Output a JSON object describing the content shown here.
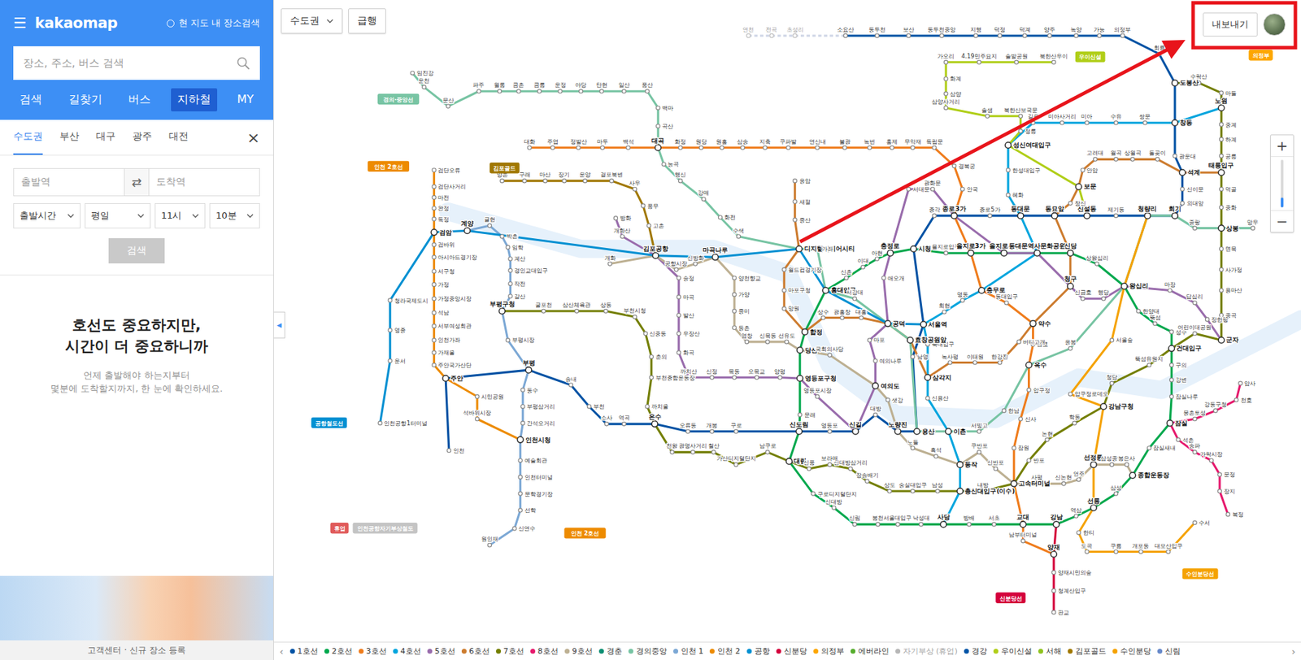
{
  "sidebar": {
    "menu_icon": "☰",
    "logo": "kakaomap",
    "area_search": {
      "label": "현 지도 내 장소검색",
      "checked": false
    },
    "search": {
      "placeholder": "장소, 주소, 버스 검색"
    },
    "nav_tabs": [
      {
        "label": "검색",
        "selected": false
      },
      {
        "label": "길찾기",
        "selected": false
      },
      {
        "label": "버스",
        "selected": false
      },
      {
        "label": "지하철",
        "selected": true
      },
      {
        "label": "MY",
        "selected": false
      }
    ],
    "region_tabs": [
      {
        "label": "수도권",
        "selected": true
      },
      {
        "label": "부산",
        "selected": false
      },
      {
        "label": "대구",
        "selected": false
      },
      {
        "label": "광주",
        "selected": false
      },
      {
        "label": "대전",
        "selected": false
      }
    ],
    "close": "×",
    "route": {
      "from_placeholder": "출발역",
      "to_placeholder": "도착역",
      "swap": "⇄"
    },
    "selects": [
      "출발시간",
      "평일",
      "11시",
      "10분"
    ],
    "submit": {
      "label": "검색",
      "disabled": true
    },
    "promo": {
      "title": [
        "호선도 중요하지만,",
        "시간이 더 중요하니까"
      ],
      "body": [
        "언제 출발해야 하는지부터",
        "몇분에 도착할지까지, 한 눈에 확인하세요."
      ]
    },
    "footer": "고객센터 · 신규 장소 등록",
    "collapse": "◀"
  },
  "map": {
    "region": "수도권",
    "express": "급행",
    "export": "내보내기",
    "zoom_in": "+",
    "zoom_out": "−",
    "zoom": {
      "level": 0.2
    },
    "legend_prev": "‹",
    "legend_next": "›",
    "faded_stations": [
      "연천",
      "전곡",
      "초성리"
    ],
    "badges": [
      {
        "text": "경의·중앙선",
        "color": "#77c4a3"
      },
      {
        "text": "인천 2호선",
        "color": "#ed8b00"
      },
      {
        "text": "김포골드",
        "color": "#a17800"
      },
      {
        "text": "우이신설",
        "color": "#b0ce18"
      },
      {
        "text": "공항철도선",
        "color": "#0090d2"
      },
      {
        "text": "의정부",
        "color": "#fda600"
      },
      {
        "text": "신분당선",
        "color": "#d4003b"
      },
      {
        "text": "수인분당선",
        "color": "#f5a200"
      },
      {
        "text": "휴업",
        "color": "#e05a5a"
      },
      {
        "text": "인천공항자기부상철도",
        "color": "#c4c4c4"
      },
      {
        "text": "인천 2호선",
        "color": "#ed8b00"
      }
    ],
    "stations": [
      "소요산",
      "동두천",
      "보산",
      "동두천중앙",
      "지행",
      "덕정",
      "덕계",
      "양주",
      "녹양",
      "가능",
      "의정부",
      "회룡",
      "도봉산",
      "창동",
      "광운대",
      "석계",
      "신이문",
      "외대앞",
      "회기",
      "청량리",
      "제기동",
      "신설동",
      "동묘앞",
      "동대문",
      "종로5가",
      "종로3가",
      "종각",
      "시청",
      "서울역",
      "남영",
      "용산",
      "노량진",
      "대방",
      "신길",
      "영등포",
      "신도림",
      "구로",
      "개봉",
      "오류동",
      "온수",
      "역곡",
      "소사",
      "부천",
      "송내",
      "부평",
      "주안",
      "인천",
      "을지로입구",
      "을지로3가",
      "을지로4가",
      "동대문역사문화공원",
      "신당",
      "상왕십리",
      "왕십리",
      "한양대",
      "뚝섬",
      "성수",
      "건대입구",
      "구의",
      "강변",
      "잠실나루",
      "잠실",
      "잠실새내",
      "종합운동장",
      "삼성",
      "선릉",
      "역삼",
      "강남",
      "교대",
      "서초",
      "방배",
      "사당",
      "낙성대",
      "서울대입구",
      "봉천",
      "신림",
      "신대방",
      "구로디지털단지",
      "대림",
      "문래",
      "영등포구청",
      "당산",
      "합정",
      "홍대입구",
      "신촌",
      "이대",
      "아현",
      "충정로",
      "대화",
      "주엽",
      "정발산",
      "마두",
      "백석",
      "대곡",
      "화정",
      "원당",
      "원흥",
      "삼송",
      "지축",
      "구파발",
      "연신내",
      "불광",
      "녹번",
      "홍제",
      "무악재",
      "독립문",
      "경복궁",
      "안국",
      "충무로",
      "동대입구",
      "약수",
      "금호",
      "옥수",
      "압구정",
      "신사",
      "잠원",
      "고속터미널",
      "남부터미널",
      "양재",
      "노원",
      "쌍문",
      "수유",
      "미아",
      "미아사거리",
      "길음",
      "성신여대입구",
      "한성대입구",
      "혜화",
      "명동",
      "회현",
      "숙대입구",
      "삼각지",
      "신용산",
      "이촌",
      "동작",
      "총신대입구(이수)",
      "방화",
      "개화산",
      "김포공항",
      "송정",
      "마곡",
      "발산",
      "우장산",
      "화곡",
      "까치산",
      "신정",
      "목동",
      "오목교",
      "양평",
      "영등포시장",
      "여의도",
      "여의나루",
      "마포",
      "공덕",
      "애오개",
      "서대문",
      "광화문",
      "청구",
      "신금호",
      "행당",
      "마장",
      "답십리",
      "장한평",
      "군자",
      "응암",
      "새절",
      "증산",
      "디지털미디어시티",
      "월드컵경기장",
      "마포구청",
      "망원",
      "상수",
      "광흥창",
      "대흥",
      "효창공원앞",
      "녹사평",
      "이태원",
      "한강진",
      "버티고개",
      "창신",
      "보문",
      "안암",
      "고려대",
      "월곡",
      "상월곡",
      "돌곶이",
      "태릉입구",
      "수락산",
      "마들",
      "중계",
      "하계",
      "공릉",
      "먹골",
      "중화",
      "상봉",
      "면목",
      "사가정",
      "용마산",
      "중곡",
      "어린이대공원",
      "뚝섬유원지",
      "청담",
      "강남구청",
      "학동",
      "논현",
      "반포",
      "내방",
      "남성",
      "숭실대입구",
      "상도",
      "장승배기",
      "신대방삼거리",
      "보라매",
      "신풍",
      "남구로",
      "가산디지털단지",
      "철산",
      "광명사거리",
      "천왕",
      "까치울",
      "부천종합운동장",
      "춘의",
      "신중동",
      "부천시청",
      "상동",
      "삼산체육관",
      "굴포천",
      "부평구청",
      "암사",
      "천호",
      "강동구청",
      "몽촌토성",
      "석촌",
      "송파",
      "가락시장",
      "문정",
      "장지",
      "복정",
      "개화",
      "공항시장",
      "신방화",
      "마곡나루",
      "양천향교",
      "가양",
      "증미",
      "등촌",
      "염창",
      "신목동",
      "선유도",
      "국회의사당",
      "샛강",
      "노들",
      "흑석",
      "구반포",
      "신반포",
      "사평",
      "신논현",
      "언주",
      "선정릉",
      "삼성중앙",
      "봉은사",
      "임진강",
      "운천",
      "문산",
      "파주",
      "월롱",
      "금촌",
      "금릉",
      "운정",
      "야당",
      "탄현",
      "일산",
      "풍산",
      "백마",
      "곡산",
      "능곡",
      "행신",
      "강매",
      "화전",
      "수색",
      "가좌",
      "서강대",
      "서빙고",
      "한남",
      "응봉",
      "중랑",
      "망우",
      "인천공항1터미널",
      "운서",
      "영종",
      "청라국제도시",
      "검암",
      "계양",
      "귤현",
      "박촌",
      "임학",
      "계산",
      "경인교대입구",
      "작전",
      "갈산",
      "부평시장",
      "동수",
      "부평삼거리",
      "간석오거리",
      "인천시청",
      "예술회관",
      "인천터미널",
      "문학경기장",
      "선학",
      "신연수",
      "원인재",
      "검단오류",
      "검단사거리",
      "마전",
      "완정",
      "독정",
      "검바위",
      "아시아드경기장",
      "서구청",
      "가정",
      "가정중앙시장",
      "석남",
      "서부여성회관",
      "인천가좌",
      "가재울",
      "주안국가산단",
      "시민공원",
      "석바위시장",
      "양재시민의숲",
      "청계산입구",
      "판교",
      "서울숲",
      "압구정로데오",
      "한티",
      "도곡",
      "구룡",
      "개포동",
      "대모산입구",
      "수서",
      "양촌",
      "구래",
      "마산",
      "장기",
      "운양",
      "걸포북변",
      "사우",
      "풍무",
      "고촌",
      "북한산우이",
      "솔밭공원",
      "4.19민주묘지",
      "가오리",
      "화계",
      "삼양",
      "삼양사거리",
      "솔샘",
      "북한산보국문",
      "정릉"
    ],
    "lines": [
      {
        "name": "1호선",
        "color": "#0052a4",
        "disabled": false,
        "stops": [
          "소요산",
          "동두천",
          "보산",
          "동두천중앙",
          "지행",
          "덕정",
          "덕계",
          "양주",
          "녹양",
          "가능",
          "의정부",
          "회룡",
          "도봉산",
          "창동",
          "광운대",
          "석계",
          "신이문",
          "외대앞",
          "회기",
          "청량리",
          "제기동",
          "신설동",
          "동묘앞",
          "동대문",
          "종로5가",
          "종로3가",
          "종각",
          "시청",
          "서울역",
          "남영",
          "용산",
          "노량진",
          "대방",
          "신길",
          "영등포",
          "신도림",
          "구로",
          "개봉",
          "오류동",
          "온수",
          "역곡",
          "소사",
          "부천",
          "송내",
          "부평",
          "주안",
          "인천"
        ]
      },
      {
        "name": "2호선",
        "color": "#00a84d",
        "disabled": false,
        "stops": [
          "시청",
          "을지로입구",
          "을지로3가",
          "을지로4가",
          "동대문역사문화공원",
          "신당",
          "상왕십리",
          "왕십리",
          "한양대",
          "뚝섬",
          "성수",
          "건대입구",
          "구의",
          "강변",
          "잠실나루",
          "잠실",
          "잠실새내",
          "종합운동장",
          "삼성",
          "선릉",
          "역삼",
          "강남",
          "교대",
          "서초",
          "방배",
          "사당",
          "낙성대",
          "서울대입구",
          "봉천",
          "신림",
          "신대방",
          "구로디지털단지",
          "대림",
          "신도림",
          "문래",
          "영등포구청",
          "당산",
          "합정",
          "홍대입구",
          "신촌",
          "이대",
          "아현",
          "충정로",
          "시청"
        ]
      },
      {
        "name": "3호선",
        "color": "#ef7c1c",
        "disabled": false,
        "stops": [
          "대화",
          "주엽",
          "정발산",
          "마두",
          "백석",
          "대곡",
          "화정",
          "원당",
          "원흥",
          "삼송",
          "지축",
          "구파발",
          "연신내",
          "불광",
          "녹번",
          "홍제",
          "무악재",
          "독립문",
          "경복궁",
          "안국",
          "종로3가",
          "을지로3가",
          "충무로",
          "동대입구",
          "약수",
          "금호",
          "옥수",
          "압구정",
          "신사",
          "잠원",
          "고속터미널",
          "교대",
          "남부터미널",
          "양재"
        ]
      },
      {
        "name": "4호선",
        "color": "#00a5de",
        "disabled": false,
        "stops": [
          "노원",
          "창동",
          "쌍문",
          "수유",
          "미아",
          "미아사거리",
          "길음",
          "성신여대입구",
          "한성대입구",
          "혜화",
          "동대문",
          "동대문역사문화공원",
          "충무로",
          "명동",
          "회현",
          "서울역",
          "숙대입구",
          "삼각지",
          "신용산",
          "이촌",
          "동작",
          "총신대입구(이수)",
          "사당"
        ]
      },
      {
        "name": "5호선",
        "color": "#996cac",
        "disabled": false,
        "stops": [
          "방화",
          "개화산",
          "김포공항",
          "송정",
          "마곡",
          "발산",
          "우장산",
          "화곡",
          "까치산",
          "신정",
          "목동",
          "오목교",
          "양평",
          "영등포구청",
          "영등포시장",
          "신길",
          "여의도",
          "여의나루",
          "마포",
          "공덕",
          "애오개",
          "충정로",
          "서대문",
          "광화문",
          "종로3가",
          "을지로4가",
          "동대문역사문화공원",
          "청구",
          "신금호",
          "행당",
          "왕십리",
          "마장",
          "답십리",
          "장한평",
          "군자"
        ]
      },
      {
        "name": "6호선",
        "color": "#cd7c2f",
        "disabled": false,
        "stops": [
          "응암",
          "새절",
          "증산",
          "디지털미디어시티",
          "월드컵경기장",
          "마포구청",
          "망원",
          "합정",
          "상수",
          "광흥창",
          "대흥",
          "공덕",
          "효창공원앞",
          "삼각지",
          "녹사평",
          "이태원",
          "한강진",
          "버티고개",
          "약수",
          "청구",
          "신당",
          "동묘앞",
          "창신",
          "보문",
          "안암",
          "고려대",
          "월곡",
          "상월곡",
          "돌곶이",
          "석계",
          "태릉입구"
        ]
      },
      {
        "name": "7호선",
        "color": "#747f00",
        "disabled": false,
        "stops": [
          "도봉산",
          "수락산",
          "마들",
          "노원",
          "중계",
          "하계",
          "공릉",
          "태릉입구",
          "먹골",
          "중화",
          "상봉",
          "면목",
          "사가정",
          "용마산",
          "중곡",
          "군자",
          "어린이대공원",
          "건대입구",
          "뚝섬유원지",
          "청담",
          "강남구청",
          "학동",
          "논현",
          "반포",
          "고속터미널",
          "내방",
          "총신대입구(이수)",
          "남성",
          "숭실대입구",
          "상도",
          "장승배기",
          "신대방삼거리",
          "보라매",
          "신풍",
          "대림",
          "남구로",
          "가산디지털단지",
          "철산",
          "광명사거리",
          "천왕",
          "온수",
          "까치울",
          "부천종합운동장",
          "춘의",
          "신중동",
          "부천시청",
          "상동",
          "삼산체육관",
          "굴포천",
          "부평구청"
        ]
      },
      {
        "name": "8호선",
        "color": "#e6186c",
        "disabled": false,
        "stops": [
          "암사",
          "천호",
          "강동구청",
          "몽촌토성",
          "잠실",
          "석촌",
          "송파",
          "가락시장",
          "문정",
          "장지",
          "복정"
        ]
      },
      {
        "name": "9호선",
        "color": "#bdb092",
        "disabled": false,
        "stops": [
          "개화",
          "김포공항",
          "공항시장",
          "신방화",
          "마곡나루",
          "양천향교",
          "가양",
          "증미",
          "등촌",
          "염창",
          "신목동",
          "선유도",
          "당산",
          "국회의사당",
          "여의도",
          "샛강",
          "노량진",
          "노들",
          "흑석",
          "동작",
          "구반포",
          "신반포",
          "고속터미널",
          "사평",
          "신논현",
          "언주",
          "선정릉",
          "삼성중앙",
          "봉은사",
          "종합운동장"
        ]
      },
      {
        "name": "경춘",
        "color": "#0c8e72",
        "disabled": false,
        "stops": []
      },
      {
        "name": "경의중앙",
        "color": "#77c4a3",
        "disabled": false,
        "stops": [
          "임진강",
          "운천",
          "문산",
          "파주",
          "월롱",
          "금촌",
          "금릉",
          "운정",
          "야당",
          "탄현",
          "일산",
          "풍산",
          "백마",
          "곡산",
          "대곡",
          "능곡",
          "행신",
          "강매",
          "화전",
          "수색",
          "디지털미디어시티",
          "가좌",
          "홍대입구",
          "서강대",
          "공덕",
          "효창공원앞",
          "용산",
          "이촌",
          "서빙고",
          "한남",
          "옥수",
          "응봉",
          "왕십리",
          "청량리",
          "회기",
          "중랑",
          "상봉",
          "망우"
        ]
      },
      {
        "name": "인천 1",
        "color": "#7ca8d5",
        "disabled": false,
        "stops": [
          "계양",
          "귤현",
          "박촌",
          "임학",
          "계산",
          "경인교대입구",
          "작전",
          "갈산",
          "부평구청",
          "부평시장",
          "부평",
          "동수",
          "부평삼거리",
          "간석오거리",
          "인천시청",
          "예술회관",
          "인천터미널",
          "문학경기장",
          "선학",
          "신연수",
          "원인재"
        ]
      },
      {
        "name": "인천 2",
        "color": "#ed8b00",
        "disabled": false,
        "stops": [
          "검단오류",
          "검단사거리",
          "마전",
          "완정",
          "독정",
          "검암",
          "검바위",
          "아시아드경기장",
          "서구청",
          "가정",
          "가정중앙시장",
          "석남",
          "서부여성회관",
          "인천가좌",
          "가재울",
          "주안국가산단",
          "주안",
          "시민공원",
          "석바위시장",
          "인천시청"
        ]
      },
      {
        "name": "공항",
        "color": "#0090d2",
        "disabled": false,
        "stops": [
          "인천공항1터미널",
          "운서",
          "영종",
          "청라국제도시",
          "검암",
          "계양",
          "김포공항",
          "마곡나루",
          "디지털미디어시티",
          "홍대입구",
          "공덕",
          "서울역"
        ]
      },
      {
        "name": "신분당",
        "color": "#d4003b",
        "disabled": false,
        "stops": [
          "강남",
          "양재",
          "양재시민의숲",
          "청계산입구",
          "판교"
        ]
      },
      {
        "name": "의정부",
        "color": "#fda600",
        "disabled": false,
        "stops": []
      },
      {
        "name": "에버라인",
        "color": "#56ad2d",
        "disabled": false,
        "stops": []
      },
      {
        "name": "자기부상 (휴업)",
        "color": "#b7b7b7",
        "disabled": true,
        "stops": []
      },
      {
        "name": "경강",
        "color": "#0054a6",
        "disabled": false,
        "stops": []
      },
      {
        "name": "우이신설",
        "color": "#b0ce18",
        "disabled": false,
        "stops": [
          "북한산우이",
          "솔밭공원",
          "4.19민주묘지",
          "가오리",
          "화계",
          "삼양",
          "삼양사거리",
          "솔샘",
          "북한산보국문",
          "정릉",
          "성신여대입구",
          "보문",
          "신설동"
        ]
      },
      {
        "name": "서해",
        "color": "#8fc31f",
        "disabled": false,
        "stops": []
      },
      {
        "name": "김포골드",
        "color": "#a17800",
        "disabled": false,
        "stops": [
          "양촌",
          "구래",
          "마산",
          "장기",
          "운양",
          "걸포북변",
          "사우",
          "풍무",
          "고촌",
          "김포공항"
        ]
      },
      {
        "name": "수인분당",
        "color": "#f5a200",
        "disabled": false,
        "stops": [
          "청량리",
          "왕십리",
          "서울숲",
          "압구정로데오",
          "강남구청",
          "선정릉",
          "선릉",
          "한티",
          "도곡",
          "구룡",
          "개포동",
          "대모산입구",
          "수서"
        ]
      },
      {
        "name": "신림",
        "color": "#6789ca",
        "disabled": false,
        "stops": []
      }
    ]
  }
}
